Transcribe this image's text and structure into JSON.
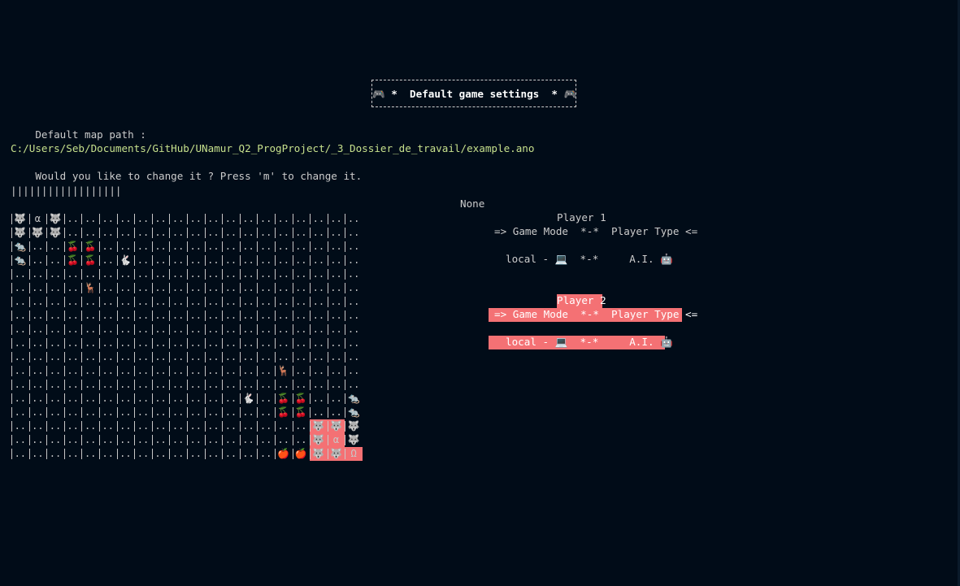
{
  "header": {
    "title_left_icon": "gamepad-icon",
    "title_text": "*  Default game settings  *",
    "title_right_icon": "gamepad-icon"
  },
  "map": {
    "label": "Default map path :",
    "path": "C:/Users/Seb/Documents/GitHub/UNamur_Q2_ProgProject/_3_Dossier_de_travail/example.ano",
    "prompt": "Would you like to change it ? Press 'm' to change it.",
    "progress_bars": "||||||||||||||||||"
  },
  "status": {
    "text": "None"
  },
  "players": [
    {
      "title": "Player 1",
      "header": "=> Game Mode  *-*  Player Type <=",
      "mode": "local -",
      "mode_icon": "laptop-icon",
      "separator": "*-*",
      "type": "A.I.",
      "type_icon": "robot-icon",
      "selected": false
    },
    {
      "title": "Player 2",
      "header": "=> Game Mode  *-*  Player Type <=",
      "mode": "local -",
      "mode_icon": "laptop-icon",
      "separator": "*-*",
      "type": "A.I.",
      "type_icon": "robot-icon",
      "selected": true
    }
  ],
  "grid": {
    "cols": 20,
    "legend": {
      ".": "..",
      "W": "🐺",
      "a": "α",
      "C": "🍒",
      "R": "🐀",
      "B": "🐇",
      "D": "🦌",
      "A": "🍎",
      "w": "🐺α",
      "o": "Ω"
    },
    "rows": [
      "Wa W . . . . . . . . . . . . . . . . .",
      "WWW. . . . . . . . . . . . . . . . .",
      "R . . CC. . . . . . . . . . . . . . .",
      "R . . CC. B . . . . . . . . . . . . .",
      ". . . . . . . . . . . . . . . . . . . .",
      ". . . . D . . . . . . . . . . . . . . .",
      ". . . . . . . . . . . . . . . . . . . .",
      ". . . . . . . . . . . . . . . . . . . .",
      ". . . . . . . . . . . . . . . . . . . .",
      ". . . . . . . . . . . . . . . . . . . .",
      ". . . . . . . . . . . . . . . . . . . .",
      ". . . . . . . . . . . . . . . . . . . .",
      ". . . . . . . . . . . . . . . . . . . .",
      ". . . . . . . . . . . . . . . . . . . .",
      ". . . . . . . . . . . . . . . . . . . .",
      ". . . . . . . . . . . . . . . . . . . .",
      ". . . . . . . . . . . . . . . . . . . .",
      ". . . . . . . . . . . . . . . . . . . .",
      ". . . . . . . . . . . . . . . . . . . ."
    ]
  }
}
